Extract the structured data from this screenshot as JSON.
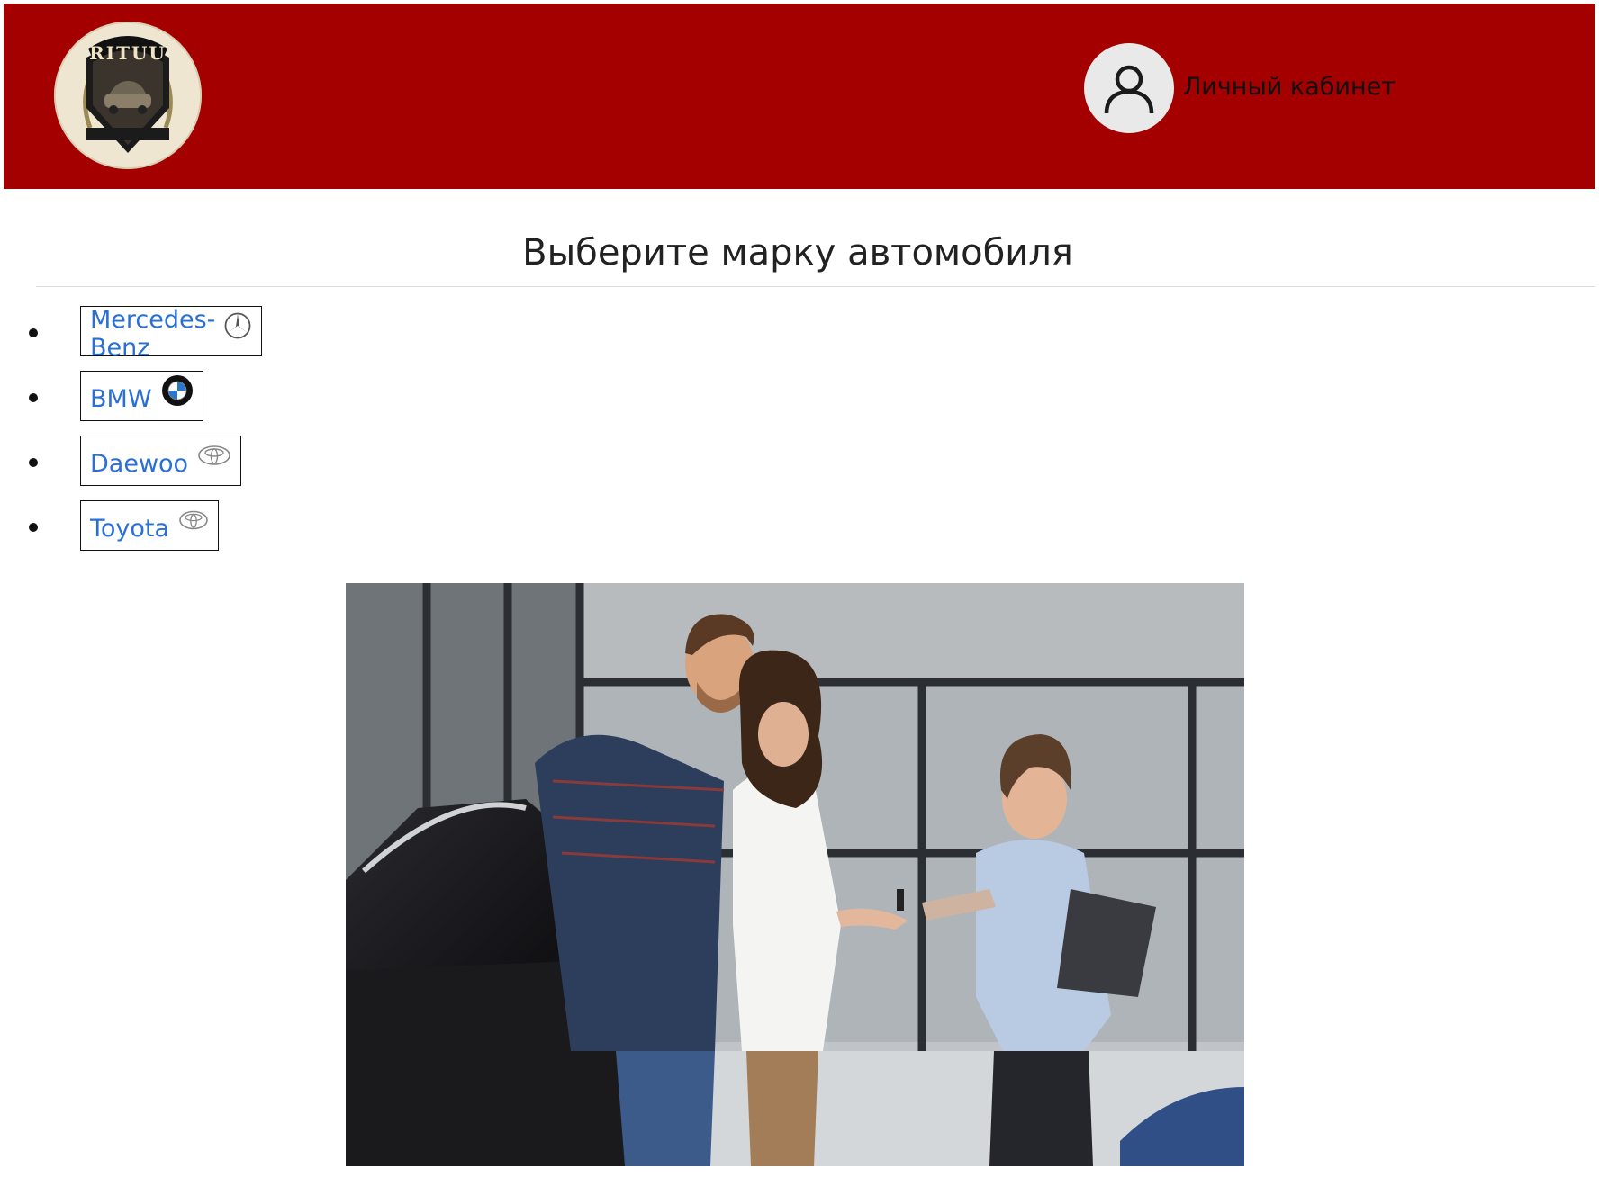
{
  "header": {
    "logo_icon": "rituu-logo-emblem",
    "logo_text": "RITUU",
    "account_label": "Личный кабинет",
    "account_icon": "user-icon",
    "background_color": "#a40000"
  },
  "main": {
    "title": "Выберите марку автомобиля",
    "brands": [
      {
        "label": "Mercedes-Benz",
        "icon": "mercedes-benz-logo-icon"
      },
      {
        "label": "BMW",
        "icon": "bmw-logo-icon"
      },
      {
        "label": "Daewoo",
        "icon": "daewoo-logo-icon"
      },
      {
        "label": "Toyota",
        "icon": "toyota-logo-icon"
      }
    ],
    "link_color": "#2a6fd6",
    "hero_image": "car-dealership-key-handover-photo"
  }
}
